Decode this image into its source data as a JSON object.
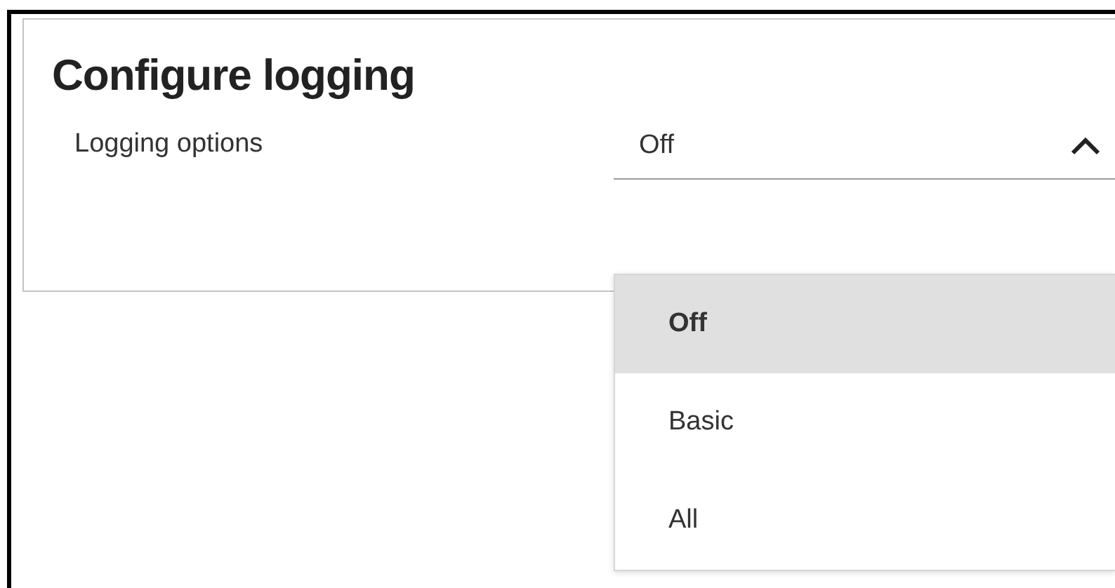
{
  "panel": {
    "title": "Configure logging",
    "field": {
      "label": "Logging options",
      "value": "Off",
      "expanded": true
    },
    "options": [
      {
        "label": "Off",
        "selected": true
      },
      {
        "label": "Basic",
        "selected": false
      },
      {
        "label": "All",
        "selected": false
      }
    ]
  }
}
